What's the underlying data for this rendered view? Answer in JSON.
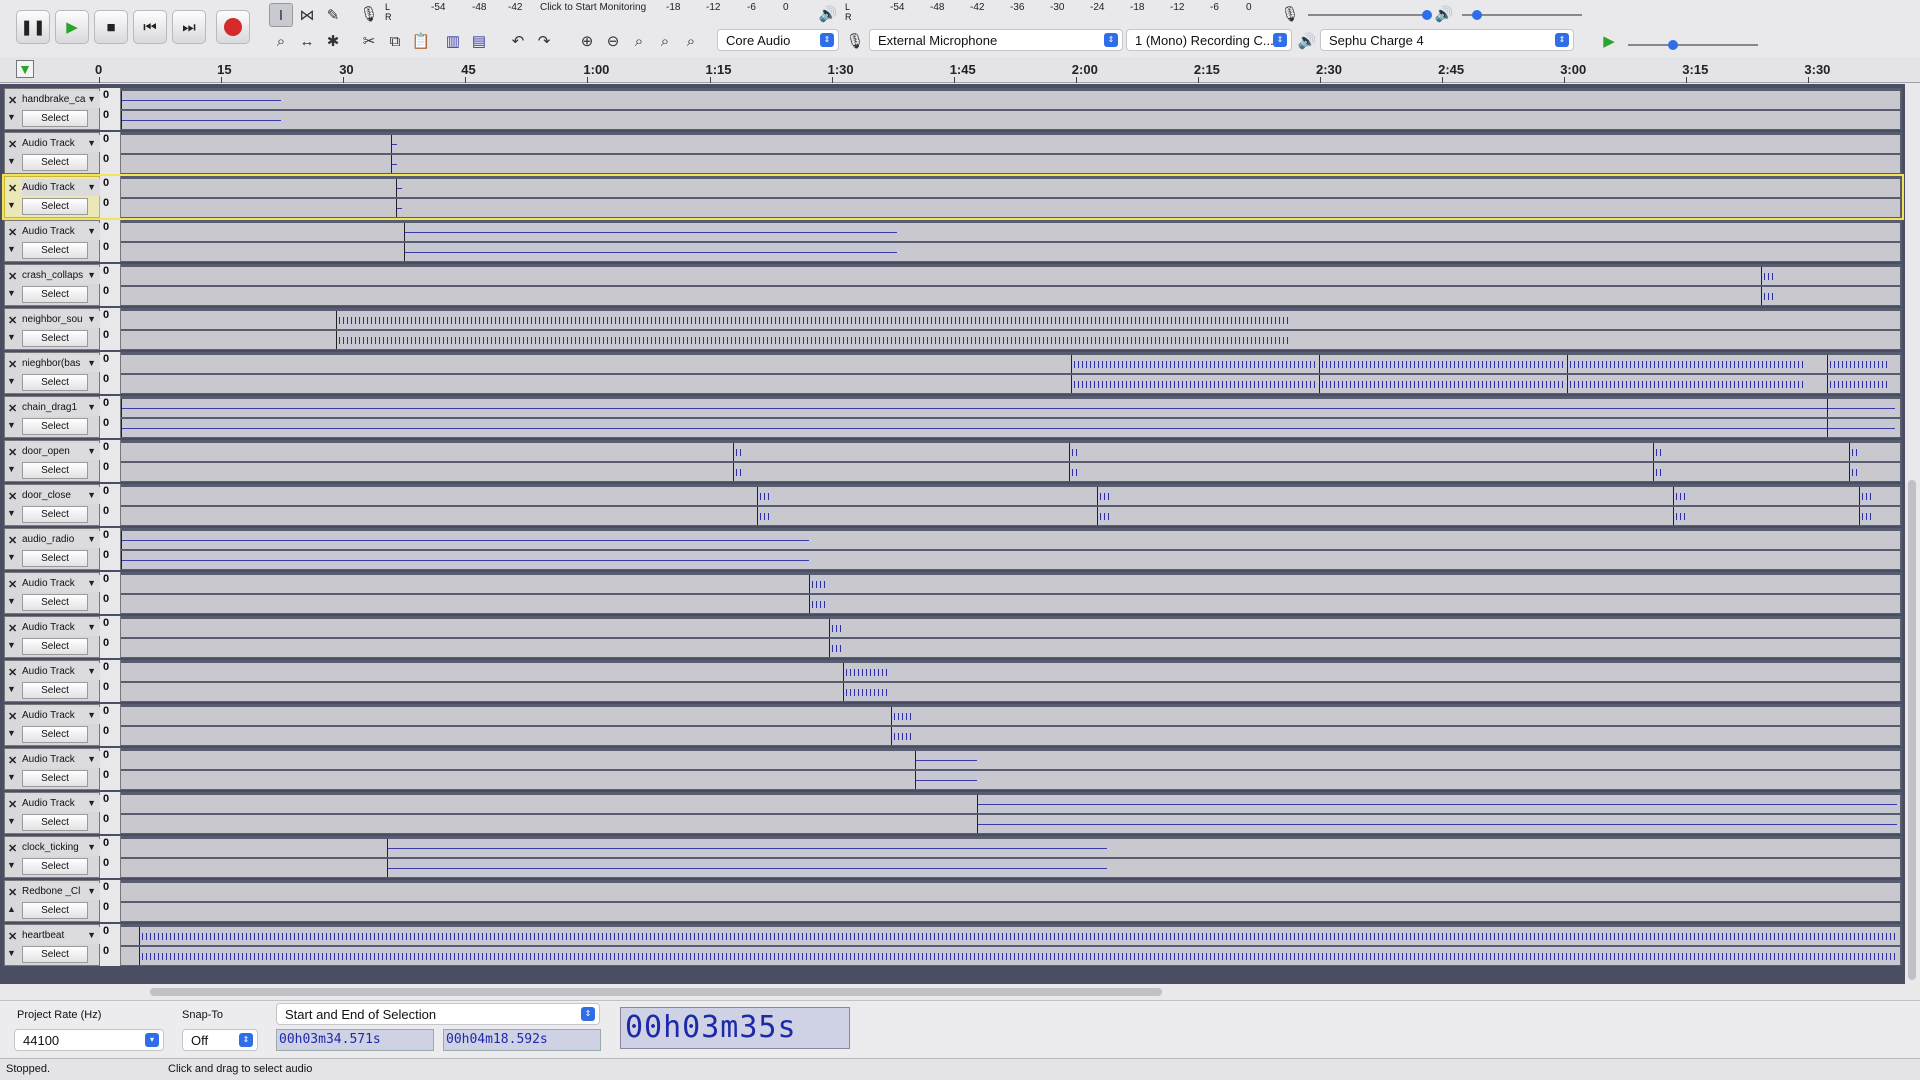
{
  "toolbar": {
    "monitor_text": "Click to Start Monitoring",
    "meter_ticks_rec": [
      "-54",
      "-48",
      "-42",
      "-18",
      "-12",
      "-6",
      "0"
    ],
    "meter_ticks_play": [
      "-54",
      "-48",
      "-42",
      "-36",
      "-30",
      "-24",
      "-18",
      "-12",
      "-6",
      "0"
    ],
    "host": "Core Audio",
    "input_device": "External Microphone",
    "input_channels": "1 (Mono) Recording C...",
    "output_device": "Sephu Charge 4",
    "transport": {
      "pause": "pause-icon",
      "play": "play-icon",
      "stop": "stop-icon",
      "skip_start": "skip-start-icon",
      "skip_end": "skip-end-icon",
      "record": "record-icon"
    }
  },
  "ruler": {
    "ticks": [
      "0",
      "15",
      "30",
      "45",
      "1:00",
      "1:15",
      "1:30",
      "1:45",
      "2:00",
      "2:15",
      "2:30",
      "2:45",
      "3:00",
      "3:15",
      "3:30"
    ]
  },
  "tracks": [
    {
      "name": "handbrake_ca",
      "select": "Select",
      "scale": "0"
    },
    {
      "name": "Audio Track",
      "select": "Select",
      "scale": "0"
    },
    {
      "name": "Audio Track",
      "select": "Select",
      "scale": "0",
      "selected": true
    },
    {
      "name": "Audio Track",
      "select": "Select",
      "scale": "0"
    },
    {
      "name": "crash_collaps",
      "select": "Select",
      "scale": "0"
    },
    {
      "name": "neighbor_sou",
      "select": "Select",
      "scale": "0"
    },
    {
      "name": "nieghbor(bas",
      "select": "Select",
      "scale": "0"
    },
    {
      "name": "chain_drag1",
      "select": "Select",
      "scale": "0"
    },
    {
      "name": "door_open",
      "select": "Select",
      "scale": "0"
    },
    {
      "name": "door_close",
      "select": "Select",
      "scale": "0"
    },
    {
      "name": "audio_radio",
      "select": "Select",
      "scale": "0"
    },
    {
      "name": "Audio Track",
      "select": "Select",
      "scale": "0"
    },
    {
      "name": "Audio Track",
      "select": "Select",
      "scale": "0"
    },
    {
      "name": "Audio Track",
      "select": "Select",
      "scale": "0"
    },
    {
      "name": "Audio Track",
      "select": "Select",
      "scale": "0"
    },
    {
      "name": "Audio Track",
      "select": "Select",
      "scale": "0"
    },
    {
      "name": "Audio Track",
      "select": "Select",
      "scale": "0"
    },
    {
      "name": "clock_ticking",
      "select": "Select",
      "scale": "0"
    },
    {
      "name": "Redbone _Cl",
      "select": "Select",
      "scale": "0"
    },
    {
      "name": "heartbeat",
      "select": "Select",
      "scale": "0"
    }
  ],
  "bottom": {
    "project_rate_label": "Project Rate (Hz)",
    "project_rate": "44100",
    "snap_label": "Snap-To",
    "snap_value": "Off",
    "selection_mode": "Start and End of Selection",
    "sel_start": "00h03m34.571s",
    "sel_end": "00h04m18.592s",
    "position": "00h03m35s"
  },
  "status": {
    "state": "Stopped.",
    "hint": "Click and drag to select audio"
  }
}
